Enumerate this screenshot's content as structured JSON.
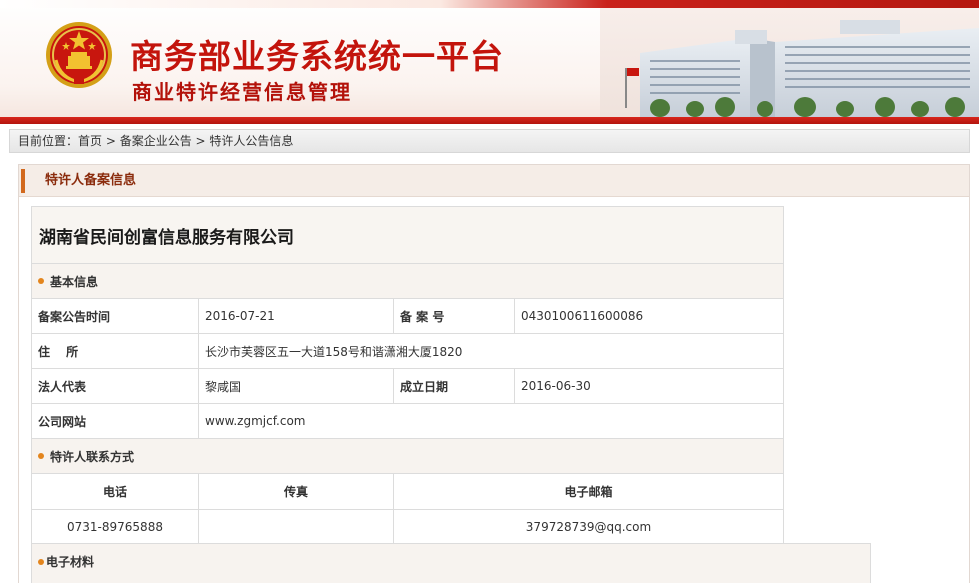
{
  "header": {
    "title": "商务部业务系统统一平台",
    "subtitle": "商业特许经营信息管理"
  },
  "breadcrumb": {
    "prefix": "目前位置：",
    "home": "首页",
    "sep1": " > ",
    "section": "备案企业公告",
    "sep2": " > ",
    "current": "特许人公告信息"
  },
  "panel": {
    "title": "特许人备案信息"
  },
  "company": {
    "name": "湖南省民间创富信息服务有限公司"
  },
  "basic_info": {
    "section_label": "基本信息",
    "filing_date_label": "备案公告时间",
    "filing_date": "2016-07-21",
    "filing_no_label": "备 案 号",
    "filing_no": "0430100611600086",
    "address_label": "住　 所",
    "address": "长沙市芙蓉区五一大道158号和谐潇湘大厦1820",
    "legal_rep_label": "法人代表",
    "legal_rep": "黎咸国",
    "established_label": "成立日期",
    "established": "2016-06-30",
    "website_label": "公司网站",
    "website": "www.zgmjcf.com"
  },
  "contact": {
    "section_label": "特许人联系方式",
    "columns": [
      "电话",
      "传真",
      "电子邮箱"
    ],
    "phone": "0731-89765888",
    "fax": "",
    "email": "379728739@qq.com"
  },
  "materials": {
    "section_label": "电子材料"
  },
  "colors": {
    "brand_red": "#c3140c",
    "accent_orange": "#e3851d",
    "section_bg": "#f7f3ef"
  }
}
